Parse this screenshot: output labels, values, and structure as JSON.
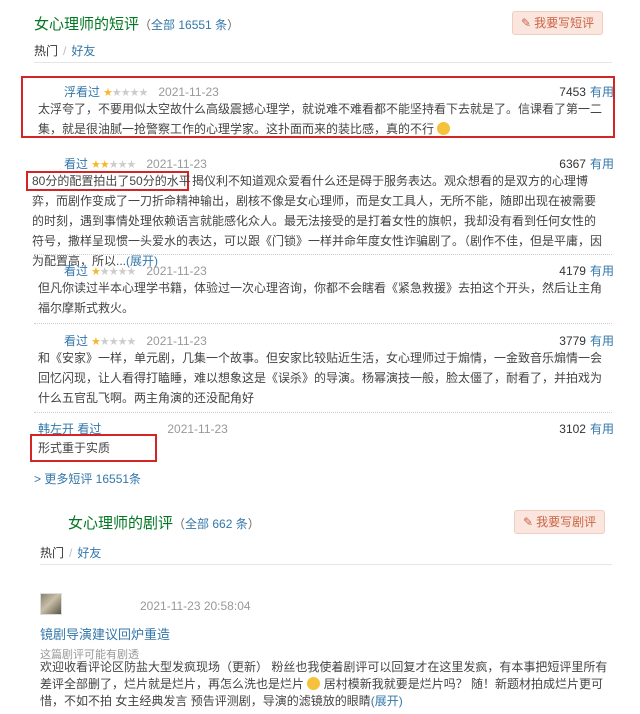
{
  "short_reviews": {
    "title": "女心理师的短评",
    "count_text": "（全部 16551 条）",
    "count_prefix": "（",
    "count_link": "全部 16551 条",
    "count_suffix": "）",
    "write_button": "我要写短评",
    "tabs": [
      "热门",
      "好友"
    ],
    "items": [
      {
        "user": "浮看过",
        "stars_on": 1,
        "date": "2021-11-23",
        "votes": "7453",
        "useful": "有用",
        "content": "太浮夸了，不要用似太空故什么高级震撼心理学，就说难不难看都不能坚持看下去就是了。信课看了第一二集，就是很油腻一抢警察工作的心理学家。这扑面而来的装比感，真的不行"
      },
      {
        "user": "看过",
        "stars_on": 2,
        "date": "2021-11-23",
        "votes": "6367",
        "useful": "有用",
        "highlight": "80分的配置拍出了50分的水平",
        "content": "揭仪利不知道观众爱看什么还是碍于服务表达。观众想看的是双方的心理博弈，而剧作变成了一刀折命精神输出，剧核不像是女心理师，而是女工具人，无所不能，随即出现在被需要的时刻，遇到事情处理依赖语言就能感化众人。最无法接受的是打着女性的旗帜，我却没有看到任何女性的符号，撒样呈现惯一头爱水的表达，可以跟《门锁》一样并命年度女性诈骗剧了。（剧作不佳，但是平庸，因为配置高，所以...",
        "expand": "(展开)"
      },
      {
        "user": "看过",
        "stars_on": 1,
        "date": "2021-11-23",
        "votes": "4179",
        "useful": "有用",
        "content": "但凡你读过半本心理学书籍，体验过一次心理咨询，你都不会瞎看《紧急救援》去拍这个开头，然后让主角福尔摩斯式救火。"
      },
      {
        "user": "看过",
        "stars_on": 1,
        "date": "2021-11-23",
        "votes": "3779",
        "useful": "有用",
        "content": "和《安家》一样，单元剧，几集一个故事。但安家比较贴近生活，女心理师过于煽情，一金致音乐煽情一会回忆闪现，让人看得打瞌睡，难以想象这是《误杀》的导演。杨幂演技一般，脸太僵了，耐看了，并拍戏为什么五官乱飞啊。两主角演的还没配角好"
      },
      {
        "user": "韩左开 看过",
        "stars_on": 0,
        "date": "2021-11-23",
        "votes": "3102",
        "useful": "有用",
        "content": "形式重于实质"
      }
    ],
    "more_link": "> 更多短评 16551条"
  },
  "drama_reviews": {
    "title": "女心理师的剧评",
    "count_prefix": "（",
    "count_link": "全部 662 条",
    "count_suffix": "）",
    "write_button": "我要写剧评",
    "tabs": [
      "热门",
      "好友"
    ],
    "items": [
      {
        "date": "2021-11-23 20:58:04",
        "title": "镜剧导演建议回炉重造",
        "note": "这篇剧评可能有剧透",
        "content_a": "欢迎收看评论区防盐大型发疯现场（更新） 粉丝也我使着剧评可以回复才在这里发疯，有本事把短评里所有差评全部删了，烂片就是烂片，再怎么洗也是烂片",
        "content_b": "居村模新我就要是烂片吗？ 随！新题材拍成烂片更可惜，不如不拍 女主经典发言",
        "content_c": "预告评测剧，导演的滤镜放的眼睛",
        "expand": "(展开)"
      }
    ]
  },
  "colors": {
    "section_green": "#007722",
    "link_blue": "#3377aa",
    "star_gold": "#f4b82e",
    "highlight_red": "#d62323",
    "write_btn_bg": "#fbe6df"
  },
  "icons": [
    "pen-icon",
    "star-icon",
    "smile-emoji-icon",
    "avatar-image"
  ]
}
